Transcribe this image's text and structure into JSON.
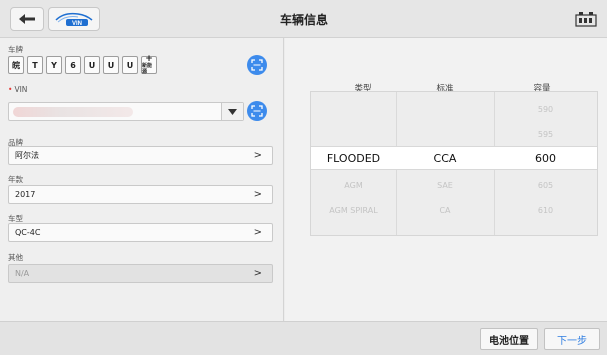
{
  "header": {
    "title": "车辆信息",
    "back_icon": "arrow-left-icon",
    "logo_text": "VIN",
    "tray_icon": "battery-tray-icon"
  },
  "form": {
    "plate_label": "车牌",
    "plate_keys": [
      "皖",
      "T",
      "Y",
      "6",
      "U",
      "U",
      "U"
    ],
    "new_energy_key": {
      "plus": "+",
      "label": "新能源"
    },
    "vin_label": "VIN",
    "brand_label": "品牌",
    "brand_value": "阿尔法",
    "year_label": "年款",
    "year_value": "2017",
    "model_label": "车型",
    "model_value": "QC-4C",
    "other_label": "其他",
    "other_value": "N/A",
    "chevron": ">"
  },
  "picker": {
    "headers": [
      "类型",
      "标准",
      "容量"
    ],
    "rows": [
      {
        "type": "",
        "standard": "",
        "capacity": "590"
      },
      {
        "type": "",
        "standard": "",
        "capacity": "595"
      },
      {
        "type": "FLOODED",
        "standard": "CCA",
        "capacity": "600"
      },
      {
        "type": "AGM",
        "standard": "SAE",
        "capacity": "605"
      },
      {
        "type": "AGM SPIRAL",
        "standard": "CA",
        "capacity": "610"
      }
    ],
    "selected_index": 2
  },
  "footer": {
    "battery_position_label": "电池位置",
    "next_label": "下一步"
  },
  "colors": {
    "accent": "#3d8bec",
    "next_text": "#2f7de1",
    "required": "#e53935"
  }
}
